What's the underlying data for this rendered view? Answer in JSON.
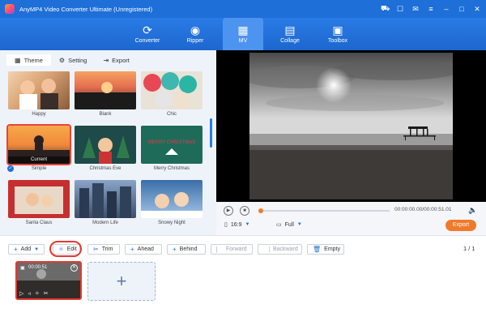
{
  "app": {
    "title": "AnyMP4 Video Converter Ultimate (Unregistered)",
    "accent": "#1e6fd8",
    "window_icons": [
      "cart-icon",
      "gift-icon",
      "chat-icon",
      "menu-icon",
      "minimize-icon",
      "maximize-icon",
      "close-icon"
    ]
  },
  "nav": [
    {
      "label": "Converter",
      "icon": "converter-icon",
      "glyph": "⟳"
    },
    {
      "label": "Ripper",
      "icon": "disc-icon",
      "glyph": "◉"
    },
    {
      "label": "MV",
      "icon": "mv-icon",
      "glyph": "▦",
      "active": true
    },
    {
      "label": "Collage",
      "icon": "collage-icon",
      "glyph": "▤"
    },
    {
      "label": "Toolbox",
      "icon": "toolbox-icon",
      "glyph": "▣"
    }
  ],
  "tabs": [
    {
      "label": "Theme",
      "icon": "grid-icon",
      "glyph": "▦",
      "active": true
    },
    {
      "label": "Setting",
      "icon": "gear-icon",
      "glyph": "⚙"
    },
    {
      "label": "Export",
      "icon": "export-icon",
      "glyph": "⇥"
    }
  ],
  "themes": [
    {
      "label": "Happy"
    },
    {
      "label": "Blank"
    },
    {
      "label": "Chic"
    },
    {
      "label": "Simple",
      "selected": true,
      "badge": "Current"
    },
    {
      "label": "Christmas Eve"
    },
    {
      "label": "Merry Christmas",
      "overlay": "MERRY CHRISTMAS"
    },
    {
      "label": "Santa Claus"
    },
    {
      "label": "Modern Life"
    },
    {
      "label": "Snowy Night"
    }
  ],
  "player": {
    "time": "00:00:00.00/00:00:51.01",
    "ratio": "16:9",
    "mode": "Full",
    "export_label": "Export"
  },
  "toolbar": {
    "add": "Add",
    "edit": "Edit",
    "trim": "Trim",
    "ahead": "Ahead",
    "behind": "Behind",
    "forward": "Forward",
    "backward": "Backward",
    "empty": "Empty",
    "pager": "1 / 1"
  },
  "clip": {
    "duration": "00:00:51"
  },
  "add_clip_glyph": "+"
}
